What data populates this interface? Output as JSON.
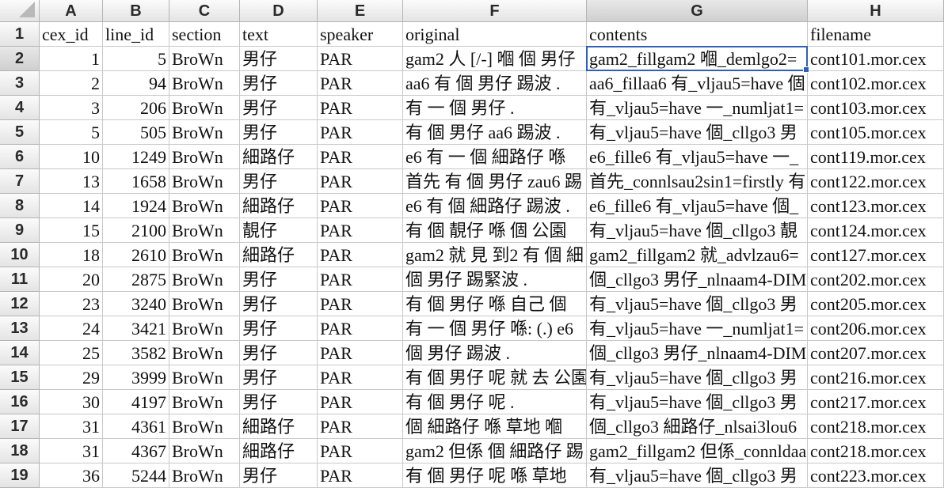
{
  "columns": [
    "A",
    "B",
    "C",
    "D",
    "E",
    "F",
    "G",
    "H"
  ],
  "active_cell": "G2",
  "header_row": [
    "cex_id",
    "line_id",
    "section",
    "text",
    "speaker",
    "original",
    "contents",
    "filename"
  ],
  "rows": [
    [
      "1",
      "5",
      "BroWn",
      "男仔",
      "PAR",
      "gam2 人 [/-] 嗰 個 男仔",
      "gam2_fillgam2 嗰_demlgo2=",
      "cont101.mor.cex"
    ],
    [
      "2",
      "94",
      "BroWn",
      "男仔",
      "PAR",
      "aa6 有 個 男仔 踢波 .",
      "aa6_fillaa6 有_vljau5=have 個",
      "cont102.mor.cex"
    ],
    [
      "3",
      "206",
      "BroWn",
      "男仔",
      "PAR",
      "有 一 個 男仔 .",
      "有_vljau5=have 一_numljat1=",
      "cont103.mor.cex"
    ],
    [
      "5",
      "505",
      "BroWn",
      "男仔",
      "PAR",
      "有 個 男仔 aa6 踢波 .",
      "有_vljau5=have 個_cllgo3 男",
      "cont105.mor.cex"
    ],
    [
      "10",
      "1249",
      "BroWn",
      "細路仔",
      "PAR",
      "e6 有 一 個 細路仔 喺",
      "e6_fille6 有_vljau5=have 一_",
      "cont119.mor.cex"
    ],
    [
      "13",
      "1658",
      "BroWn",
      "男仔",
      "PAR",
      "首先 有 個 男仔 zau6 踢",
      "首先_connlsau2sin1=firstly 有",
      "cont122.mor.cex"
    ],
    [
      "14",
      "1924",
      "BroWn",
      "細路仔",
      "PAR",
      "e6 有 個 細路仔 踢波 .",
      "e6_fille6 有_vljau5=have 個_",
      "cont123.mor.cex"
    ],
    [
      "15",
      "2100",
      "BroWn",
      "靚仔",
      "PAR",
      "有 個 靚仔 喺 個 公園",
      "有_vljau5=have 個_cllgo3 靚",
      "cont124.mor.cex"
    ],
    [
      "18",
      "2610",
      "BroWn",
      "細路仔",
      "PAR",
      "gam2 就 見 到2 有 個 細",
      "gam2_fillgam2 就_advlzau6=",
      "cont127.mor.cex"
    ],
    [
      "20",
      "2875",
      "BroWn",
      "男仔",
      "PAR",
      "個 男仔 踢緊波 .",
      "個_cllgo3 男仔_nlnaam4-DIM",
      "cont202.mor.cex"
    ],
    [
      "23",
      "3240",
      "BroWn",
      "男仔",
      "PAR",
      "有 個 男仔 喺 自己 個",
      "有_vljau5=have 個_cllgo3 男",
      "cont205.mor.cex"
    ],
    [
      "24",
      "3421",
      "BroWn",
      "男仔",
      "PAR",
      "有 一 個 男仔 喺: (.) e6",
      "有_vljau5=have 一_numljat1=",
      "cont206.mor.cex"
    ],
    [
      "25",
      "3582",
      "BroWn",
      "男仔",
      "PAR",
      "個 男仔 踢波 .",
      "個_cllgo3 男仔_nlnaam4-DIM",
      "cont207.mor.cex"
    ],
    [
      "29",
      "3999",
      "BroWn",
      "男仔",
      "PAR",
      "有 個 男仔 呢 就 去 公園",
      "有_vljau5=have 個_cllgo3 男",
      "cont216.mor.cex"
    ],
    [
      "30",
      "4197",
      "BroWn",
      "男仔",
      "PAR",
      "有 個 男仔 呢 .",
      "有_vljau5=have 個_cllgo3 男",
      "cont217.mor.cex"
    ],
    [
      "31",
      "4361",
      "BroWn",
      "細路仔",
      "PAR",
      "個 細路仔 喺 草地 嗰",
      "個_cllgo3 細路仔_nlsai3lou6",
      "cont218.mor.cex"
    ],
    [
      "31",
      "4367",
      "BroWn",
      "細路仔",
      "PAR",
      "gam2 但係 個 細路仔 踢",
      "gam2_fillgam2 但係_connldaa",
      "cont218.mor.cex"
    ],
    [
      "36",
      "5244",
      "BroWn",
      "男仔",
      "PAR",
      "有 個 男仔 呢 喺 草地",
      "有_vljau5=have 個_cllgo3 男",
      "cont223.mor.cex"
    ]
  ]
}
